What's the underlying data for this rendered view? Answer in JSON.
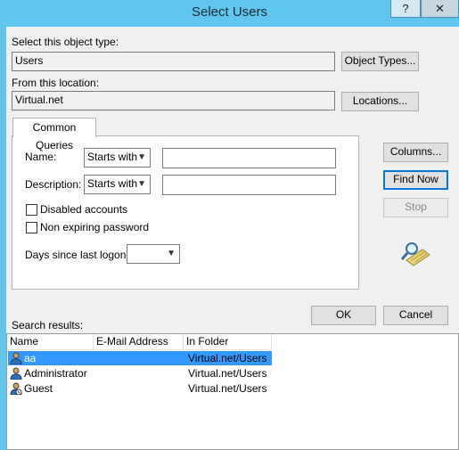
{
  "window": {
    "title": "Select Users",
    "help_glyph": "?",
    "close_glyph": "✕"
  },
  "object_type": {
    "label": "Select this object type:",
    "value": "Users",
    "button": "Object Types..."
  },
  "location": {
    "label": "From this location:",
    "value": "Virtual.net",
    "button": "Locations..."
  },
  "queries": {
    "tab_label": "Common Queries",
    "name_label": "Name:",
    "name_mode": "Starts with",
    "description_label": "Description:",
    "description_mode": "Starts with",
    "disabled_accounts": "Disabled accounts",
    "non_expiring_password": "Non expiring password",
    "days_since_logon_label": "Days since last logon:"
  },
  "side_buttons": {
    "columns": "Columns...",
    "find_now": "Find Now",
    "stop": "Stop"
  },
  "dialog_buttons": {
    "ok": "OK",
    "cancel": "Cancel"
  },
  "results": {
    "label": "Search results:",
    "columns": [
      "Name",
      "E-Mail Address",
      "In Folder"
    ],
    "rows": [
      {
        "name": "aa",
        "email": "",
        "folder": "Virtual.net/Users",
        "selected": true
      },
      {
        "name": "Administrator",
        "email": "",
        "folder": "Virtual.net/Users",
        "selected": false
      },
      {
        "name": "Guest",
        "email": "",
        "folder": "Virtual.net/Users",
        "selected": false
      }
    ]
  },
  "colors": {
    "title_bar": "#60c6ee",
    "selection": "#3399ff",
    "default_button_border": "#0078d7"
  }
}
